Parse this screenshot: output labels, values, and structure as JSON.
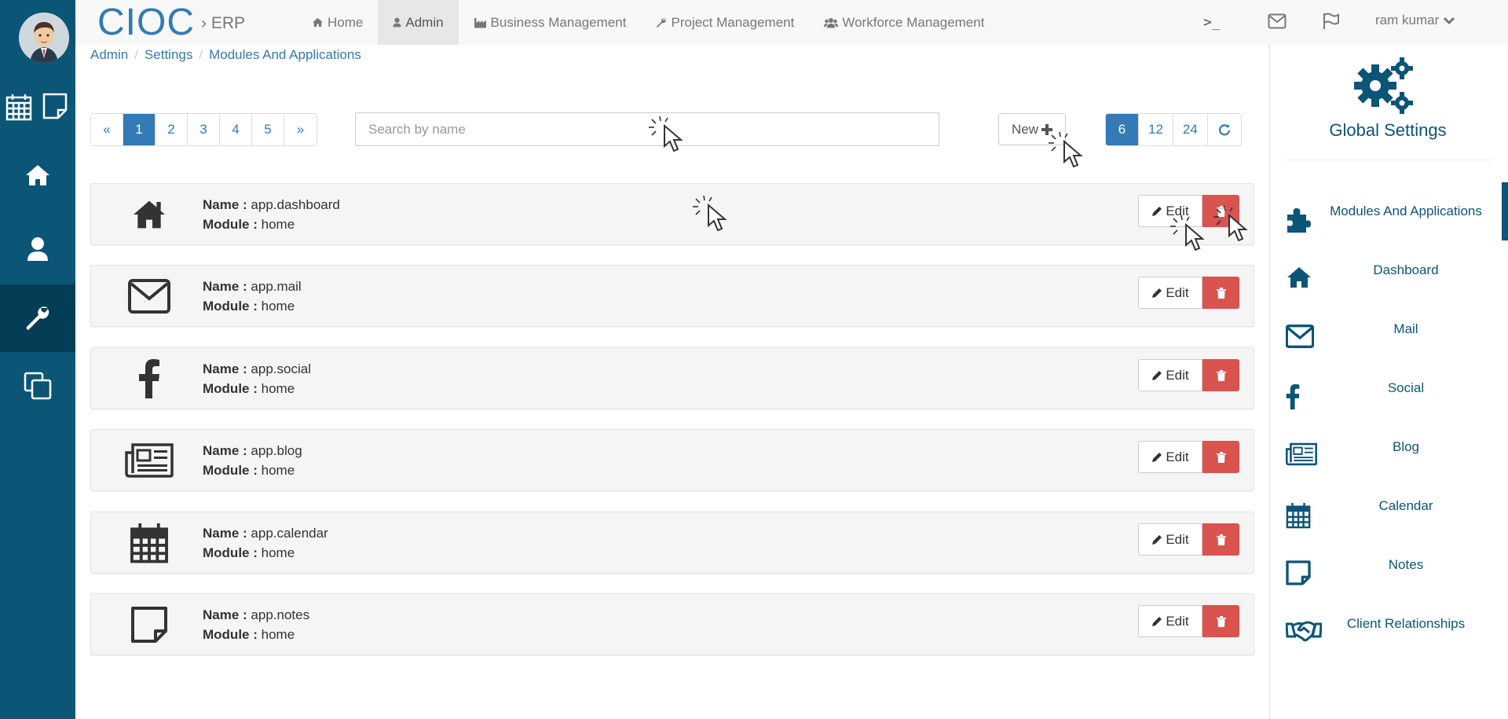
{
  "brand": {
    "name": "CIOC",
    "sub": "› ERP"
  },
  "nav": [
    {
      "label": "Home",
      "icon": "home-icon"
    },
    {
      "label": "Admin",
      "icon": "user-icon",
      "active": true
    },
    {
      "label": "Business Management",
      "icon": "industry-icon"
    },
    {
      "label": "Project Management",
      "icon": "wrench-icon"
    },
    {
      "label": "Workforce Management",
      "icon": "users-icon"
    }
  ],
  "topbar": {
    "terminal": ">_",
    "user": "ram kumar"
  },
  "breadcrumb": [
    "Admin",
    "Settings",
    "Modules And Applications"
  ],
  "pager": [
    "«",
    "1",
    "2",
    "3",
    "4",
    "5",
    "»"
  ],
  "search": {
    "placeholder": "Search by name",
    "value": ""
  },
  "new_button": "New",
  "per_page": [
    "6",
    "12",
    "24"
  ],
  "labels": {
    "name": "Name :",
    "module": "Module :",
    "edit": "Edit"
  },
  "modules": [
    {
      "name": "app.dashboard",
      "module": "home",
      "icon": "home-icon"
    },
    {
      "name": "app.mail",
      "module": "home",
      "icon": "envelope-icon"
    },
    {
      "name": "app.social",
      "module": "home",
      "icon": "facebook-icon"
    },
    {
      "name": "app.blog",
      "module": "home",
      "icon": "newspaper-icon"
    },
    {
      "name": "app.calendar",
      "module": "home",
      "icon": "calendar-icon"
    },
    {
      "name": "app.notes",
      "module": "home",
      "icon": "sticky-note-icon"
    }
  ],
  "right_panel": {
    "title": "Global Settings",
    "items": [
      {
        "label": "Modules And Applications",
        "icon": "puzzle-icon",
        "active": true
      },
      {
        "label": "Dashboard",
        "icon": "home-icon"
      },
      {
        "label": "Mail",
        "icon": "envelope-icon"
      },
      {
        "label": "Social",
        "icon": "facebook-icon"
      },
      {
        "label": "Blog",
        "icon": "newspaper-icon"
      },
      {
        "label": "Calendar",
        "icon": "calendar-icon"
      },
      {
        "label": "Notes",
        "icon": "sticky-note-icon"
      },
      {
        "label": "Client Relationships",
        "icon": "handshake-icon"
      }
    ]
  },
  "colors": {
    "rail": "#0b5576",
    "primary": "#337ab7",
    "danger": "#d9534f"
  }
}
